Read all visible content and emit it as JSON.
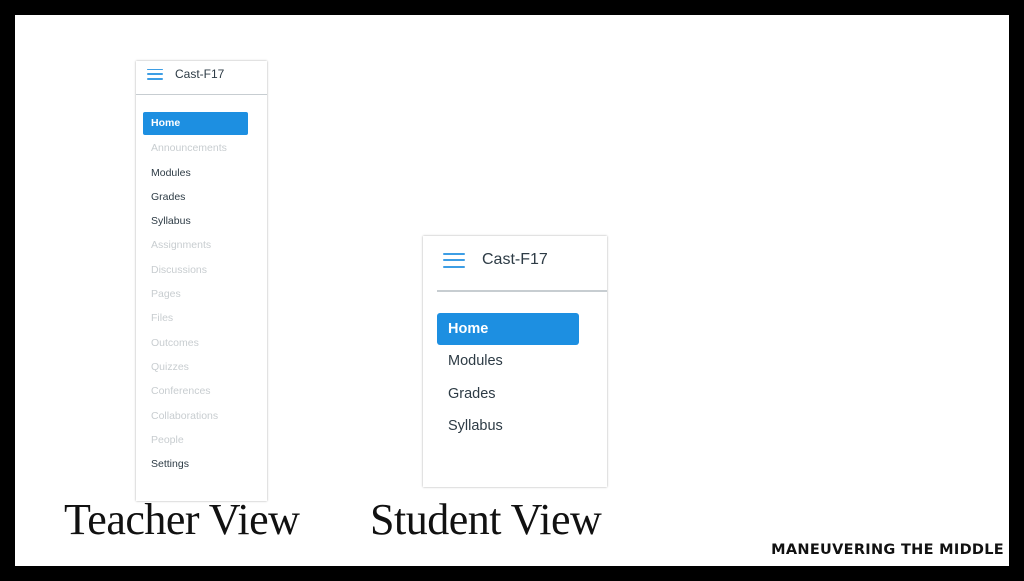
{
  "teacher_view": {
    "course_title": "Cast-F17",
    "menu_icon": "hamburger-menu-icon",
    "nav_items": [
      {
        "label": "Home",
        "state": "active"
      },
      {
        "label": "Announcements",
        "state": "disabled"
      },
      {
        "label": "Modules",
        "state": "enabled"
      },
      {
        "label": "Grades",
        "state": "enabled"
      },
      {
        "label": "Syllabus",
        "state": "enabled"
      },
      {
        "label": "Assignments",
        "state": "disabled"
      },
      {
        "label": "Discussions",
        "state": "disabled"
      },
      {
        "label": "Pages",
        "state": "disabled"
      },
      {
        "label": "Files",
        "state": "disabled"
      },
      {
        "label": "Outcomes",
        "state": "disabled"
      },
      {
        "label": "Quizzes",
        "state": "disabled"
      },
      {
        "label": "Conferences",
        "state": "disabled"
      },
      {
        "label": "Collaborations",
        "state": "disabled"
      },
      {
        "label": "People",
        "state": "disabled"
      },
      {
        "label": "Settings",
        "state": "enabled"
      }
    ]
  },
  "student_view": {
    "course_title": "Cast-F17",
    "menu_icon": "hamburger-menu-icon",
    "nav_items": [
      {
        "label": "Home",
        "state": "active"
      },
      {
        "label": "Modules",
        "state": "enabled"
      },
      {
        "label": "Grades",
        "state": "enabled"
      },
      {
        "label": "Syllabus",
        "state": "enabled"
      }
    ]
  },
  "captions": {
    "teacher": "Teacher View",
    "student": "Student View"
  },
  "brand": "MANEUVERING THE MIDDLE",
  "colors": {
    "accent": "#1d8fe1",
    "menu_icon": "#3d9ee5",
    "text": "#2d3b45",
    "disabled_text": "#c8cdd0"
  }
}
